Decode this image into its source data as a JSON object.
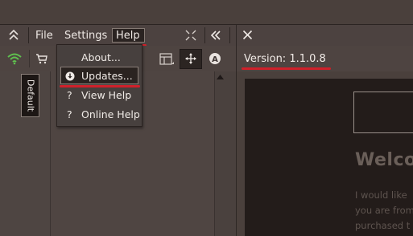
{
  "menubar": {
    "items": [
      "File",
      "Settings",
      "Help"
    ]
  },
  "help_menu": {
    "items": [
      {
        "icon": "none",
        "label": "About..."
      },
      {
        "icon": "download-circle-icon",
        "label": "Updates..."
      },
      {
        "icon": "question-icon",
        "glyph": "?",
        "label": "View Help"
      },
      {
        "icon": "question-icon",
        "glyph": "?",
        "label": "Online Help"
      }
    ]
  },
  "left_panel": {
    "tab_label": "Default"
  },
  "about_panel": {
    "version": "Version: 1.1.0.8",
    "heading": "Welco",
    "paragraph_lines": [
      "I would like",
      "you are from",
      "purchased t"
    ]
  },
  "colors": {
    "background": "#4a403c",
    "accent_underline": "#d0202a",
    "wifi_icon": "#5fc14f"
  }
}
